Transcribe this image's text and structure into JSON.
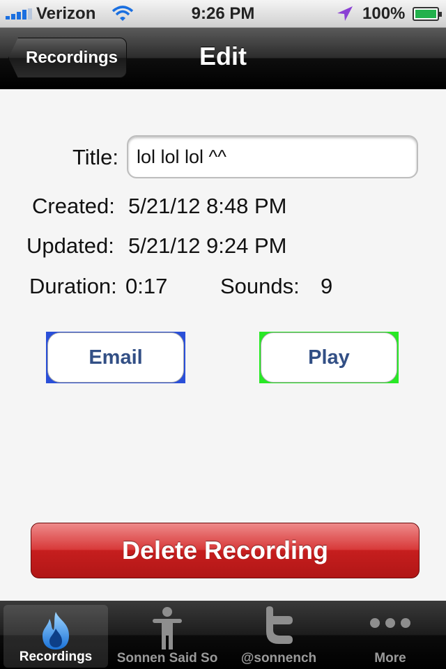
{
  "status_bar": {
    "carrier": "Verizon",
    "time": "9:26 PM",
    "battery": "100%"
  },
  "nav": {
    "back_label": "Recordings",
    "title": "Edit"
  },
  "form": {
    "title_label": "Title:",
    "title_value": "lol lol lol ^^",
    "created_label": "Created:",
    "created_value": "5/21/12 8:48 PM",
    "updated_label": "Updated:",
    "updated_value": "5/21/12 9:24 PM",
    "duration_label": "Duration:",
    "duration_value": "0:17",
    "sounds_label": "Sounds:",
    "sounds_value": "9"
  },
  "actions": {
    "email_label": "Email",
    "play_label": "Play",
    "delete_label": "Delete Recording"
  },
  "tabbar": {
    "tabs": [
      {
        "label": "Recordings",
        "icon": "flame-icon",
        "active": true
      },
      {
        "label": "Sonnen Said So",
        "icon": "person-icon",
        "active": false
      },
      {
        "label": "@sonnench",
        "icon": "twitter-icon",
        "active": false
      },
      {
        "label": "More",
        "icon": "more-dots-icon",
        "active": false
      }
    ]
  },
  "colors": {
    "email_frame": "#2a4fd8",
    "play_frame": "#29e826",
    "delete_red": "#c61e1e",
    "button_text": "#324f85"
  }
}
